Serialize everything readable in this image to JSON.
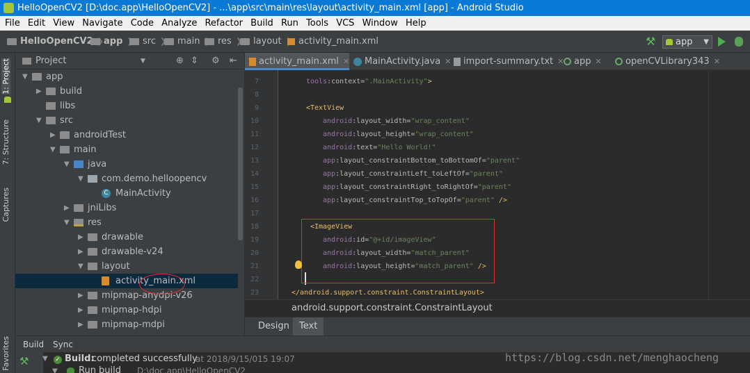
{
  "window": {
    "title": "HelloOpenCV2 [D:\\doc.app\\HelloOpenCV2] - ...\\app\\src\\main\\res\\layout\\activity_main.xml [app] - Android Studio"
  },
  "menu": [
    "File",
    "Edit",
    "View",
    "Navigate",
    "Code",
    "Analyze",
    "Refactor",
    "Build",
    "Run",
    "Tools",
    "VCS",
    "Window",
    "Help"
  ],
  "nav": {
    "crumbs": [
      "HelloOpenCV2",
      "app",
      "src",
      "main",
      "res",
      "layout",
      "activity_main.xml"
    ],
    "run_config": "app"
  },
  "side_tabs": [
    "1: Project",
    "7: Structure",
    "Captures",
    "2: Favorites"
  ],
  "project": {
    "header": "Project",
    "tree": [
      {
        "label": "app",
        "icon": "folder",
        "arrow": "down"
      },
      {
        "label": "build",
        "icon": "folder",
        "arrow": "right"
      },
      {
        "label": "libs",
        "icon": "folder",
        "arrow": ""
      },
      {
        "label": "src",
        "icon": "folder",
        "arrow": "down"
      },
      {
        "label": "androidTest",
        "icon": "folder",
        "arrow": "right"
      },
      {
        "label": "main",
        "icon": "folder",
        "arrow": "down"
      },
      {
        "label": "java",
        "icon": "src-folder",
        "arrow": "down"
      },
      {
        "label": "com.demo.helloopencv",
        "icon": "pkg",
        "arrow": "down"
      },
      {
        "label": "MainActivity",
        "icon": "cls",
        "arrow": ""
      },
      {
        "label": "jniLibs",
        "icon": "folder",
        "arrow": "right"
      },
      {
        "label": "res",
        "icon": "res-folder",
        "arrow": "down"
      },
      {
        "label": "drawable",
        "icon": "folder",
        "arrow": "right"
      },
      {
        "label": "drawable-v24",
        "icon": "folder",
        "arrow": "right"
      },
      {
        "label": "layout",
        "icon": "folder",
        "arrow": "down"
      },
      {
        "label": "activity_main.xml",
        "icon": "xml",
        "arrow": ""
      },
      {
        "label": "mipmap-anydpi-v26",
        "icon": "folder",
        "arrow": "right"
      },
      {
        "label": "mipmap-hdpi",
        "icon": "folder",
        "arrow": "right"
      },
      {
        "label": "mipmap-mdpi",
        "icon": "folder",
        "arrow": "right"
      }
    ]
  },
  "editor": {
    "tabs": [
      {
        "label": "activity_main.xml",
        "icon": "xml"
      },
      {
        "label": "MainActivity.java",
        "icon": "class"
      },
      {
        "label": "import-summary.txt",
        "icon": "txt"
      },
      {
        "label": "app",
        "icon": "gradle"
      },
      {
        "label": "openCVLibrary343",
        "icon": "gradle"
      }
    ],
    "line_numbers": [
      "7",
      "8",
      "9",
      "10",
      "11",
      "12",
      "13",
      "14",
      "15",
      "16",
      "17",
      "18",
      "19",
      "20",
      "21",
      "22",
      "23"
    ],
    "code_lines": [
      [
        [
          "ns",
          "tools"
        ],
        [
          "attr",
          ":context="
        ],
        [
          "str",
          "\".MainActivity\""
        ],
        [
          "tag",
          ">"
        ]
      ],
      [],
      [
        [
          "tag",
          "<TextView"
        ]
      ],
      [
        [
          "ns",
          "android"
        ],
        [
          "attr",
          ":layout_width="
        ],
        [
          "str",
          "\"wrap_content\""
        ]
      ],
      [
        [
          "ns",
          "android"
        ],
        [
          "attr",
          ":layout_height="
        ],
        [
          "str",
          "\"wrap_content\""
        ]
      ],
      [
        [
          "ns",
          "android"
        ],
        [
          "attr",
          ":text="
        ],
        [
          "str",
          "\"Hello World!\""
        ]
      ],
      [
        [
          "ns",
          "app"
        ],
        [
          "attr",
          ":layout_constraintBottom_toBottomOf="
        ],
        [
          "str",
          "\"parent\""
        ]
      ],
      [
        [
          "ns",
          "app"
        ],
        [
          "attr",
          ":layout_constraintLeft_toLeftOf="
        ],
        [
          "str",
          "\"parent\""
        ]
      ],
      [
        [
          "ns",
          "app"
        ],
        [
          "attr",
          ":layout_constraintRight_toRightOf="
        ],
        [
          "str",
          "\"parent\""
        ]
      ],
      [
        [
          "ns",
          "app"
        ],
        [
          "attr",
          ":layout_constraintTop_toTopOf="
        ],
        [
          "str",
          "\"parent\""
        ],
        [
          "tag",
          " />"
        ]
      ],
      [],
      [
        [
          "tag",
          "<ImageView"
        ]
      ],
      [
        [
          "ns",
          "android"
        ],
        [
          "attr",
          ":id="
        ],
        [
          "str",
          "\"@+id/imageView\""
        ]
      ],
      [
        [
          "ns",
          "android"
        ],
        [
          "attr",
          ":layout_width="
        ],
        [
          "str",
          "\"match_parent\""
        ]
      ],
      [
        [
          "ns",
          "android"
        ],
        [
          "attr",
          ":layout_height="
        ],
        [
          "str",
          "\"match_parent\""
        ],
        [
          "tag",
          " />"
        ]
      ],
      [],
      [
        [
          "tag",
          "</android.support.constraint.ConstraintLayout>"
        ]
      ]
    ],
    "breadcrumb": "android.support.constraint.ConstraintLayout",
    "mode_tabs": [
      "Design",
      "Text"
    ]
  },
  "bottom": {
    "tabs": [
      "Build",
      "Sync"
    ],
    "build_label": "Build:",
    "build_status": "completed successfully",
    "build_time": "at 2018/9/15/015 19:07",
    "run_build": "Run build",
    "run_build_path": "D:\\doc.app\\HelloOpenCV2"
  },
  "watermark": "https://blog.csdn.net/menghaocheng"
}
